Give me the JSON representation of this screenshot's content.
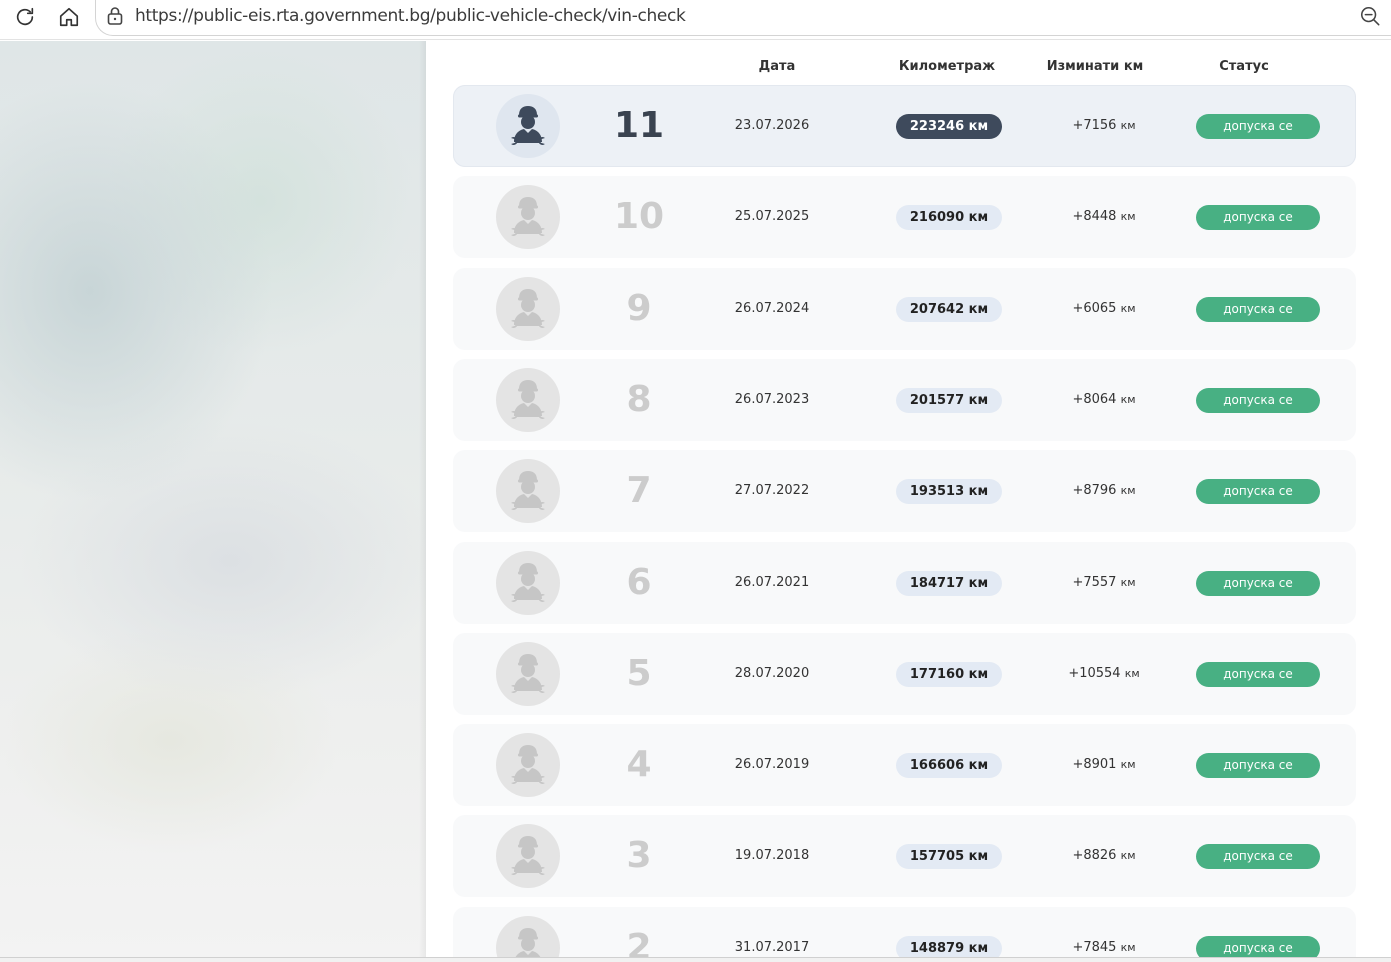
{
  "browser": {
    "url": "https://public-eis.rta.government.bg/public-vehicle-check/vin-check"
  },
  "table": {
    "headers": {
      "date": "Дата",
      "mileage": "Километраж",
      "change": "Изминати км",
      "status": "Статус"
    },
    "rows": [
      {
        "num": "11",
        "date": "23.07.2026",
        "mileage": "223246 км",
        "change": "+7156",
        "unit": "км",
        "status": "допуска се",
        "active": true
      },
      {
        "num": "10",
        "date": "25.07.2025",
        "mileage": "216090 км",
        "change": "+8448",
        "unit": "км",
        "status": "допуска се"
      },
      {
        "num": "9",
        "date": "26.07.2024",
        "mileage": "207642 км",
        "change": "+6065",
        "unit": "км",
        "status": "допуска се"
      },
      {
        "num": "8",
        "date": "26.07.2023",
        "mileage": "201577 км",
        "change": "+8064",
        "unit": "км",
        "status": "допуска се"
      },
      {
        "num": "7",
        "date": "27.07.2022",
        "mileage": "193513 км",
        "change": "+8796",
        "unit": "км",
        "status": "допуска се"
      },
      {
        "num": "6",
        "date": "26.07.2021",
        "mileage": "184717 км",
        "change": "+7557",
        "unit": "км",
        "status": "допуска се"
      },
      {
        "num": "5",
        "date": "28.07.2020",
        "mileage": "177160 км",
        "change": "+10554",
        "unit": "км",
        "status": "допуска се"
      },
      {
        "num": "4",
        "date": "26.07.2019",
        "mileage": "166606 км",
        "change": "+8901",
        "unit": "км",
        "status": "допуска се"
      },
      {
        "num": "3",
        "date": "19.07.2018",
        "mileage": "157705 км",
        "change": "+8826",
        "unit": "км",
        "status": "допуска се"
      },
      {
        "num": "2",
        "date": "31.07.2017",
        "mileage": "148879 км",
        "change": "+7845",
        "unit": "км",
        "status": "допуска се"
      }
    ]
  },
  "colors": {
    "active_row": "#edf1f6",
    "active_mileage_badge": "#3e4a5c",
    "mileage_badge": "#e3eaf4",
    "status_green": "#48b083"
  },
  "icons": {
    "reload": "reload-icon",
    "home": "home-icon",
    "site_info": "lock-icon",
    "zoom": "zoom-out-icon",
    "mechanic": "mechanic-icon"
  }
}
